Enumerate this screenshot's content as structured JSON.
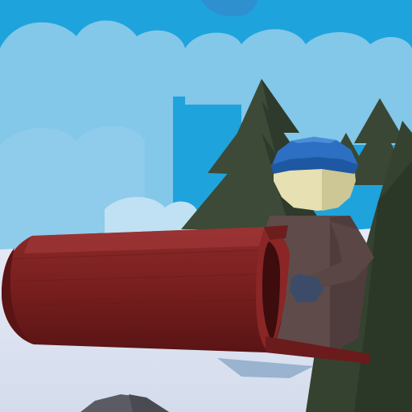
{
  "scene": {
    "type": "low-poly 3D game viewport",
    "colors": {
      "sky": "#1fa3dc",
      "clouds": "#83c7e9",
      "snow": "#dfe6f3",
      "pine_trees": "#3b4a36",
      "log": "#7b1f1f",
      "character_body": "#5d4a48",
      "character_face": "#e6e0b0",
      "beanie": "#2a6fc4",
      "mitten": "#3b4b66",
      "rock": "#5b5b63"
    },
    "elements": [
      "sky",
      "clouds",
      "snow-ground",
      "pine-trees",
      "log-cannon",
      "character",
      "rock"
    ]
  }
}
